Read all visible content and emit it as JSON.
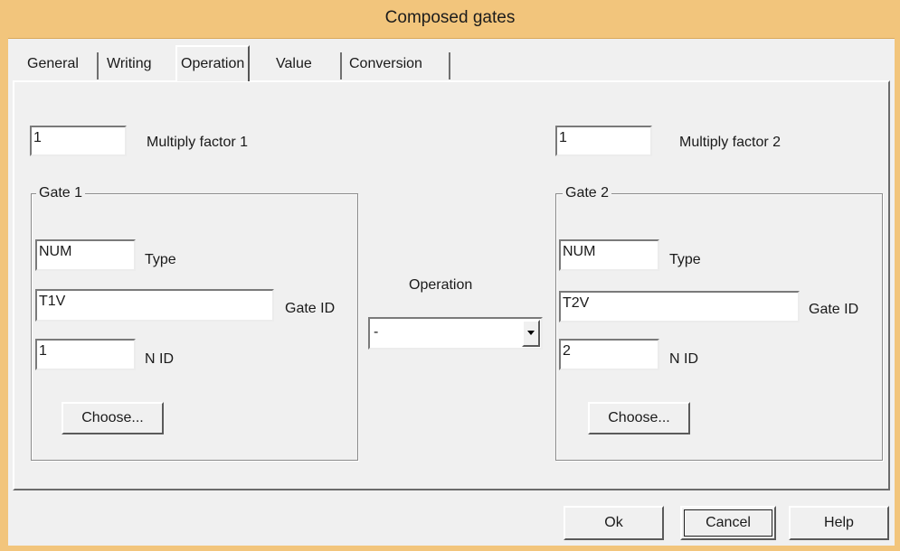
{
  "window": {
    "title": "Composed gates"
  },
  "tabs": [
    {
      "label": "General",
      "active": false
    },
    {
      "label": "Writing",
      "active": false
    },
    {
      "label": "Operation",
      "active": true
    },
    {
      "label": "Value",
      "active": false
    },
    {
      "label": "Conversion",
      "active": false
    }
  ],
  "left": {
    "multiply_factor_value": "1",
    "multiply_factor_label": "Multiply factor 1",
    "group_label": "Gate 1",
    "type_value": "NUM",
    "type_label": "Type",
    "gate_id_value": "T1V",
    "gate_id_label": "Gate ID",
    "nid_value": "1",
    "nid_label": "N ID",
    "choose_label": "Choose..."
  },
  "right": {
    "multiply_factor_value": "1",
    "multiply_factor_label": "Multiply factor 2",
    "group_label": "Gate 2",
    "type_value": "NUM",
    "type_label": "Type",
    "gate_id_value": "T2V",
    "gate_id_label": "Gate ID",
    "nid_value": "2",
    "nid_label": "N ID",
    "choose_label": "Choose..."
  },
  "operation": {
    "label": "Operation",
    "selected": "-",
    "arrow_icon": "chevron-down-icon"
  },
  "buttons": {
    "ok": "Ok",
    "cancel": "Cancel",
    "help": "Help"
  },
  "colors": {
    "frame": "#f2c57c",
    "dialog_bg": "#f0f0f0"
  }
}
